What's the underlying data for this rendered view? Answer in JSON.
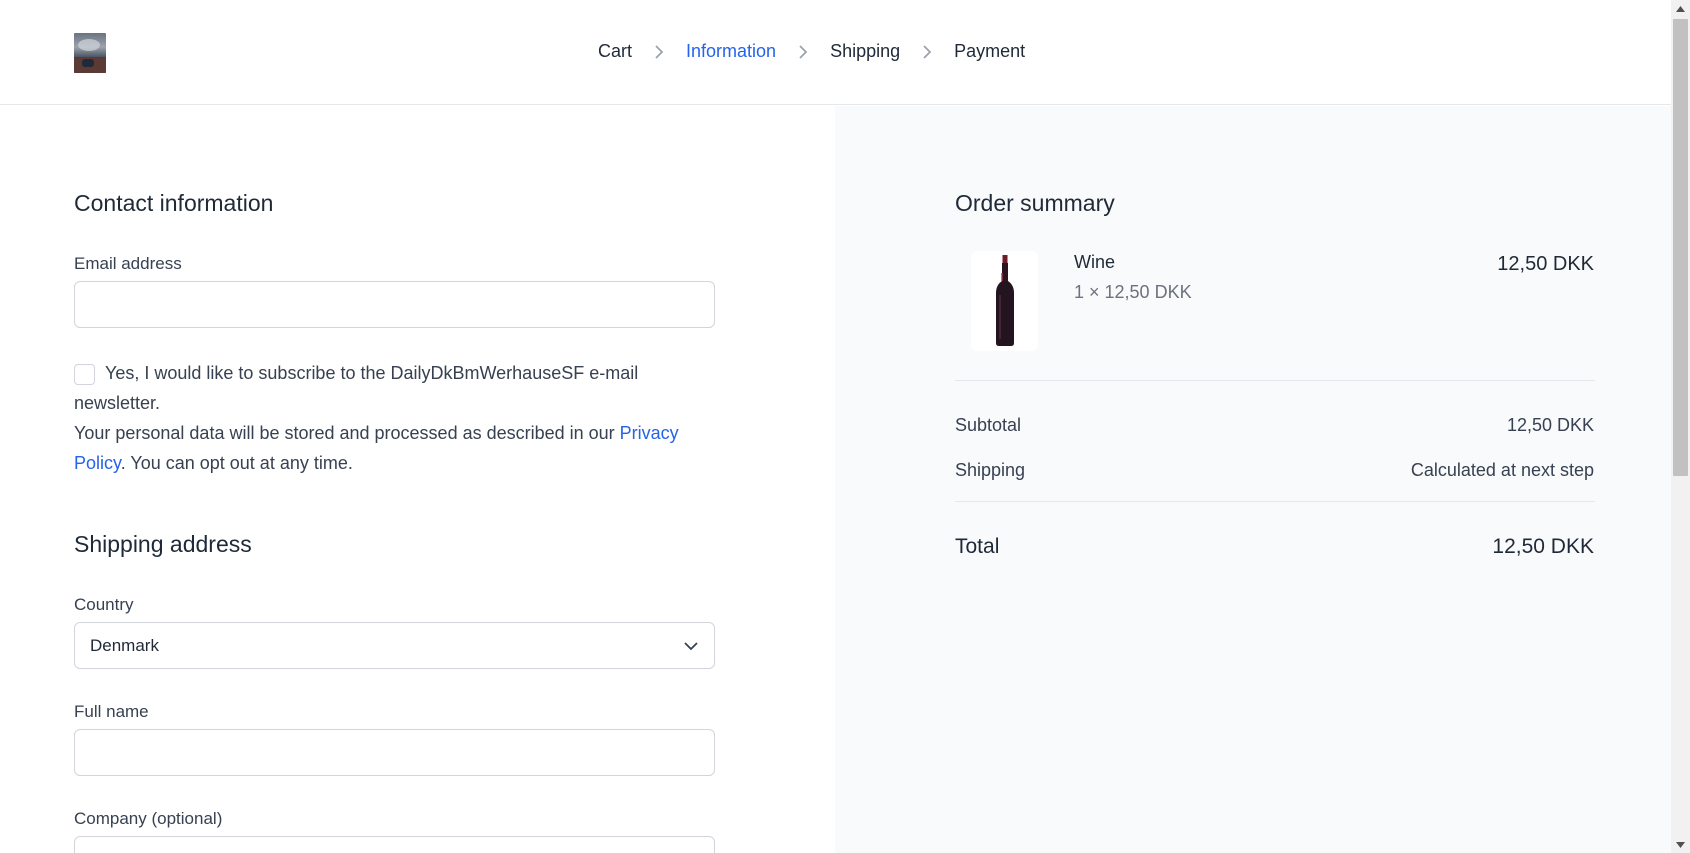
{
  "header": {
    "steps": [
      {
        "label": "Cart",
        "active": false
      },
      {
        "label": "Information",
        "active": true
      },
      {
        "label": "Shipping",
        "active": false
      },
      {
        "label": "Payment",
        "active": false
      }
    ]
  },
  "contact": {
    "title": "Contact information",
    "email_label": "Email address",
    "email_value": "",
    "newsletter_checked": false,
    "newsletter_text": "Yes, I would like to subscribe to the DailyDkBmWerhauseSF e-mail newsletter.",
    "privacy_text_before": "Your personal data will be stored and processed as described in our ",
    "privacy_link": "Privacy Policy",
    "privacy_text_after": ". You can opt out at any time."
  },
  "shipping": {
    "title": "Shipping address",
    "country_label": "Country",
    "country_value": "Denmark",
    "fullname_label": "Full name",
    "fullname_value": "",
    "company_label": "Company (optional)",
    "company_value": ""
  },
  "summary": {
    "title": "Order summary",
    "item": {
      "name": "Wine",
      "qty_line": "1 × 12,50 DKK",
      "price": "12,50 DKK"
    },
    "subtotal_label": "Subtotal",
    "subtotal_value": "12,50 DKK",
    "shipping_label": "Shipping",
    "shipping_value": "Calculated at next step",
    "total_label": "Total",
    "total_value": "12,50 DKK"
  },
  "colors": {
    "accent": "#2563eb",
    "panel_bg": "#f9fafb",
    "border": "#d1d5db"
  }
}
